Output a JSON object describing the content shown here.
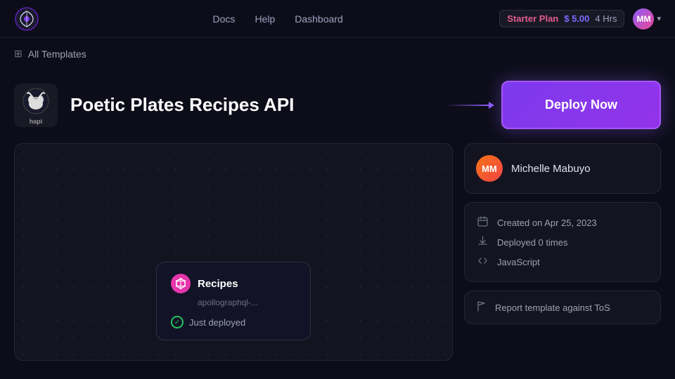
{
  "navbar": {
    "logo_alt": "Logo",
    "links": [
      {
        "label": "Docs",
        "id": "docs"
      },
      {
        "label": "Help",
        "id": "help"
      },
      {
        "label": "Dashboard",
        "id": "dashboard"
      }
    ],
    "plan": {
      "name": "Starter Plan",
      "price": "$ 5.00",
      "hours": "4 Hrs"
    },
    "avatar_initials": "MM"
  },
  "breadcrumb": {
    "icon": "⊞",
    "text": "All Templates"
  },
  "template": {
    "logo_line1": "hapi",
    "title": "Poetic Plates Recipes API",
    "deploy_button_label": "Deploy Now"
  },
  "recipe_card": {
    "name": "Recipes",
    "subtext": "apollographql-...",
    "status": "Just deployed",
    "graphql_symbol": "◈"
  },
  "right_panel": {
    "author": {
      "name": "Michelle Mabuyo",
      "initials": "MM"
    },
    "meta": [
      {
        "icon": "📅",
        "label": "Created on Apr 25, 2023",
        "id": "created"
      },
      {
        "icon": "⬇",
        "label": "Deployed 0 times",
        "id": "deployed"
      },
      {
        "icon": "</>",
        "label": "JavaScript",
        "id": "language"
      }
    ],
    "report": {
      "icon": "⚑",
      "label": "Report template against ToS"
    }
  }
}
